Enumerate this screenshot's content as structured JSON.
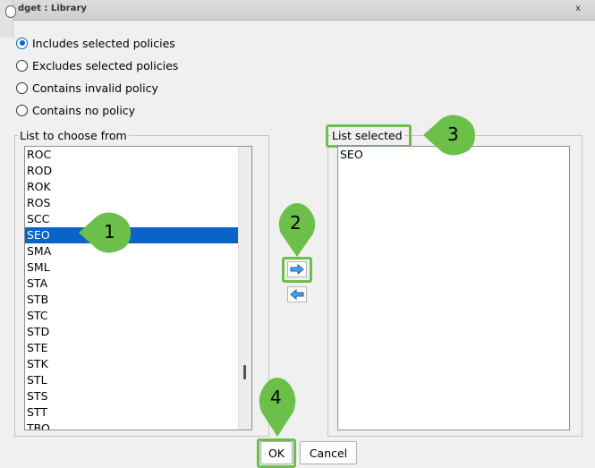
{
  "window": {
    "title": "dget : Library",
    "close_label": "x"
  },
  "filter_options": [
    {
      "label": "Includes selected policies",
      "selected": true
    },
    {
      "label": "Excludes selected policies",
      "selected": false
    },
    {
      "label": "Contains invalid policy",
      "selected": false
    },
    {
      "label": "Contains no policy",
      "selected": false
    }
  ],
  "choose_panel": {
    "label": "List to choose from",
    "items": [
      "ROC",
      "ROD",
      "ROK",
      "ROS",
      "SCC",
      "SEO",
      "SMA",
      "SML",
      "STA",
      "STB",
      "STC",
      "STD",
      "STE",
      "STK",
      "STL",
      "STS",
      "STT",
      "TBO"
    ],
    "selected_item": "SEO"
  },
  "selected_panel": {
    "label": "List selected",
    "items": [
      "SEO"
    ]
  },
  "transfer": {
    "add_icon": "right-arrow-icon",
    "remove_icon": "left-arrow-icon"
  },
  "footer": {
    "ok_label": "OK",
    "cancel_label": "Cancel"
  },
  "callouts": [
    "1",
    "2",
    "3",
    "4"
  ],
  "colors": {
    "selection": "#0a64c8",
    "highlight": "#6cc04a"
  }
}
